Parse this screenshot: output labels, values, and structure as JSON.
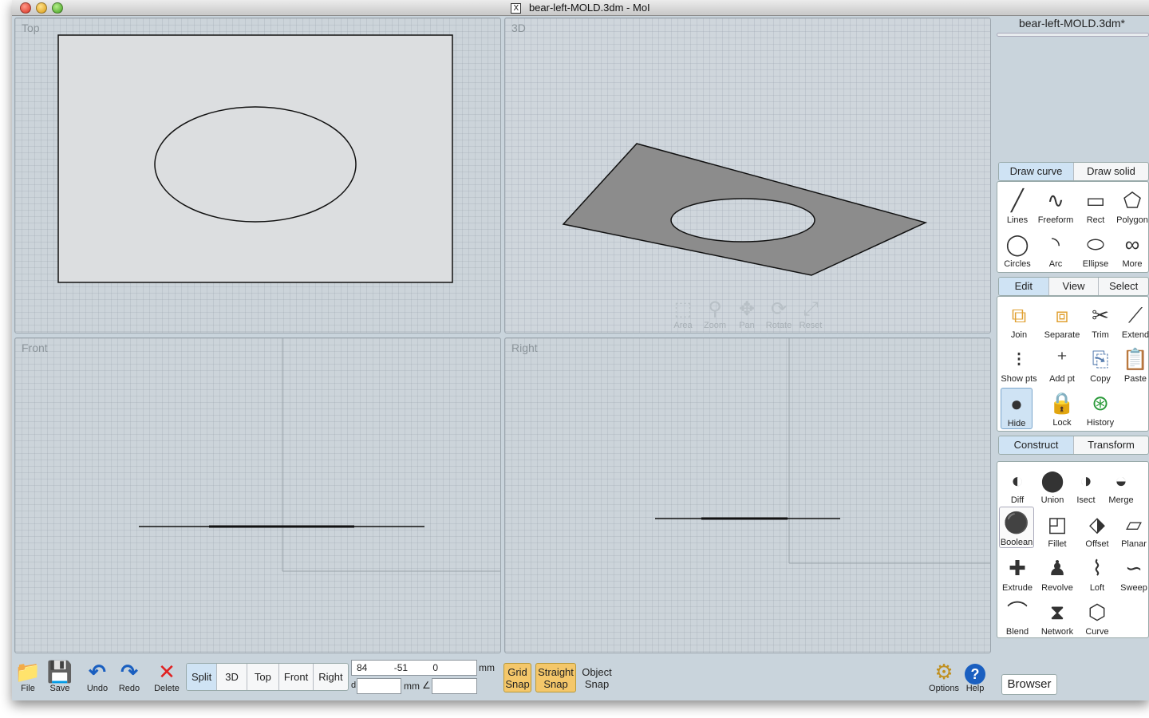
{
  "window": {
    "title": "bear-left-MOLD.3dm - MoI",
    "title_icon": "X"
  },
  "viewports": {
    "top": {
      "label": "Top"
    },
    "three_d": {
      "label": "3D"
    },
    "front": {
      "label": "Front"
    },
    "right": {
      "label": "Right"
    },
    "nav_tools": [
      {
        "label": "Area",
        "icon": "area-zoom-icon",
        "glyph": "⬚"
      },
      {
        "label": "Zoom",
        "icon": "magnifier-icon",
        "glyph": "⚲"
      },
      {
        "label": "Pan",
        "icon": "pan-arrows-icon",
        "glyph": "✥"
      },
      {
        "label": "Rotate",
        "icon": "rotate-icon",
        "glyph": "⟳"
      },
      {
        "label": "Reset",
        "icon": "reset-view-icon",
        "glyph": "⤢"
      }
    ]
  },
  "side": {
    "filename": "bear-left-MOLD.3dm*",
    "draw_tabs": [
      "Draw curve",
      "Draw solid"
    ],
    "draw_tools": [
      {
        "label": "Lines",
        "glyph": "╱"
      },
      {
        "label": "Freeform",
        "glyph": "∿"
      },
      {
        "label": "Rect",
        "glyph": "▭"
      },
      {
        "label": "Polygon",
        "glyph": "⬠"
      },
      {
        "label": "Circles",
        "glyph": "◯"
      },
      {
        "label": "Arc",
        "glyph": "◝"
      },
      {
        "label": "Ellipse",
        "glyph": "⬭"
      },
      {
        "label": "More",
        "glyph": "∞"
      }
    ],
    "edit_tabs": [
      "Edit",
      "View",
      "Select"
    ],
    "edit_tools": [
      {
        "label": "Join",
        "glyph": "⧉"
      },
      {
        "label": "Separate",
        "glyph": "⧈"
      },
      {
        "label": "Trim",
        "glyph": "✂"
      },
      {
        "label": "Extend",
        "glyph": "⟋"
      },
      {
        "label": "Show pts",
        "glyph": "⁝"
      },
      {
        "label": "Add pt",
        "glyph": "⁺"
      },
      {
        "label": "Copy",
        "glyph": "⎘"
      },
      {
        "label": "Paste",
        "glyph": "📋"
      },
      {
        "label": "Hide",
        "glyph": "●"
      },
      {
        "label": "Lock",
        "glyph": "🔒"
      },
      {
        "label": "History",
        "glyph": "⊛"
      }
    ],
    "construct_tabs": [
      "Construct",
      "Transform"
    ],
    "boolean_tools": [
      {
        "label": "Diff",
        "glyph": "◐"
      },
      {
        "label": "Union",
        "glyph": "⬤"
      },
      {
        "label": "Isect",
        "glyph": "◑"
      },
      {
        "label": "Merge",
        "glyph": "◒"
      }
    ],
    "construct_tools": [
      {
        "label": "Boolean",
        "glyph": "⚫"
      },
      {
        "label": "Fillet",
        "glyph": "◰"
      },
      {
        "label": "Offset",
        "glyph": "⬗"
      },
      {
        "label": "Planar",
        "glyph": "▱"
      },
      {
        "label": "Extrude",
        "glyph": "✚"
      },
      {
        "label": "Revolve",
        "glyph": "♟"
      },
      {
        "label": "Loft",
        "glyph": "⌇"
      },
      {
        "label": "Sweep",
        "glyph": "∽"
      },
      {
        "label": "Blend",
        "glyph": "⌒"
      },
      {
        "label": "Network",
        "glyph": "⧗"
      },
      {
        "label": "Curve",
        "glyph": "⬡"
      }
    ]
  },
  "bottom": {
    "file_buttons": [
      {
        "label": "File",
        "glyph": "📁"
      },
      {
        "label": "Save",
        "glyph": "💾"
      },
      {
        "label": "Undo",
        "glyph": "↶"
      },
      {
        "label": "Redo",
        "glyph": "↷"
      },
      {
        "label": "Delete",
        "glyph": "✕"
      }
    ],
    "view_modes": [
      "Split",
      "3D",
      "Top",
      "Front",
      "Right"
    ],
    "coords": {
      "x": "84",
      "y": "-51",
      "z": "0",
      "unit": "mm",
      "d_label": "d",
      "d_unit": "mm",
      "angle_symbol": "∠"
    },
    "grid_snap": "Grid\nSnap",
    "straight_snap": "Straight\nSnap",
    "object_snap": "Object\nSnap",
    "options": {
      "label": "Options",
      "glyph": "⚙"
    },
    "help": {
      "label": "Help",
      "glyph": "?"
    },
    "browser": "Browser"
  },
  "colors": {
    "accent_tab": "#cfe3f4",
    "snap_on": "#f4c76a",
    "delete_red": "#e02020",
    "blue_icon": "#1a5fc0",
    "face_gray": "#8c8c8c"
  }
}
